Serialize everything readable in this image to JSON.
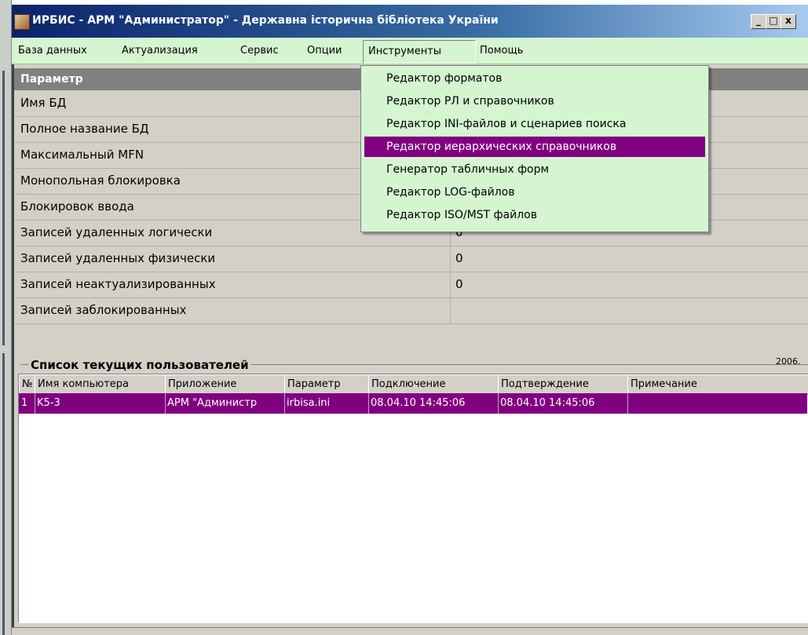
{
  "window": {
    "title": "ИРБИС - АРМ \"Администратор\" - Державна історична бібліотека України",
    "controls": {
      "minimize": "_",
      "maximize": "□",
      "close": "x"
    }
  },
  "menubar": {
    "items": [
      "База данных",
      "Актуализация",
      "Сервис",
      "Опции",
      "Инструменты",
      "Помощь"
    ]
  },
  "dropdown": {
    "items": [
      "Редактор форматов",
      "Редактор РЛ и справочников",
      "Редактор INI-файлов и сценариев поиска",
      "Редактор иерархических справочников",
      "Генератор табличных форм",
      "Редактор LOG-файлов",
      "Редактор ISO/MST файлов"
    ],
    "selected_index": 3
  },
  "params": {
    "header": "Параметр",
    "rows": [
      {
        "name": "Имя БД",
        "value": ""
      },
      {
        "name": "Полное название БД",
        "value": ""
      },
      {
        "name": "Максимальный MFN",
        "value": ""
      },
      {
        "name": "Монопольная блокировка",
        "value": ""
      },
      {
        "name": "Блокировок ввода",
        "value": ""
      },
      {
        "name": "Записей удаленных логически",
        "value": "0"
      },
      {
        "name": "Записей удаленных физически",
        "value": "0"
      },
      {
        "name": "Записей неактуализированных",
        "value": "0"
      },
      {
        "name": "Записей заблокированных",
        "value": ""
      }
    ]
  },
  "users": {
    "title": "Список текущих пользователей",
    "date_fragment": "2006.",
    "columns": [
      "№",
      "Имя компьютера",
      "Приложение",
      "Параметр",
      "Подключение",
      "Подтверждение",
      "Примечание"
    ],
    "rows": [
      [
        "1",
        "K5-3",
        "АРМ \"Администр",
        "irbisa.ini",
        "08.04.10 14:45:06",
        "08.04.10 14:45:06",
        ""
      ]
    ]
  },
  "colors": {
    "menu_bg": "#d4f5d0",
    "selection": "#800080",
    "title_bar": "#0a246a"
  }
}
